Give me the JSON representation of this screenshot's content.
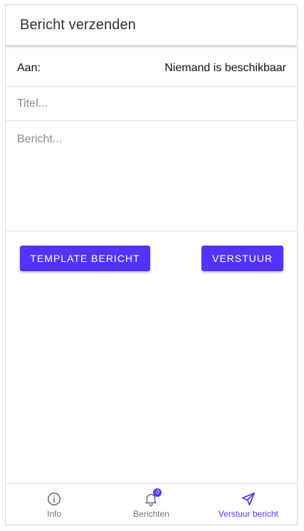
{
  "header": {
    "title": "Bericht verzenden"
  },
  "form": {
    "to_label": "Aan:",
    "to_value": "Niemand is beschikbaar",
    "title_placeholder": "Titel...",
    "title_value": "",
    "message_placeholder": "Bericht...",
    "message_value": ""
  },
  "actions": {
    "template_label": "Template bericht",
    "send_label": "Verstuur"
  },
  "tabs": [
    {
      "label": "Info",
      "icon": "info-icon",
      "active": false
    },
    {
      "label": "Berichten",
      "icon": "bell-icon",
      "badge": "0",
      "active": false
    },
    {
      "label": "Verstuur bericht",
      "icon": "send-icon",
      "active": true
    }
  ],
  "colors": {
    "accent": "#5533ff",
    "inactive": "#757575",
    "divider": "#e0e0e0"
  }
}
